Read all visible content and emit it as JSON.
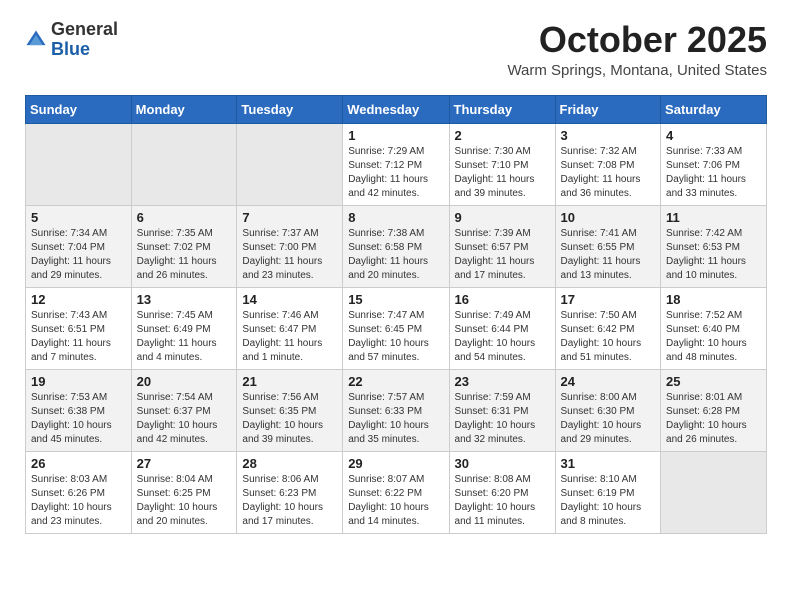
{
  "header": {
    "logo_general": "General",
    "logo_blue": "Blue",
    "month_title": "October 2025",
    "location": "Warm Springs, Montana, United States"
  },
  "weekdays": [
    "Sunday",
    "Monday",
    "Tuesday",
    "Wednesday",
    "Thursday",
    "Friday",
    "Saturday"
  ],
  "weeks": [
    [
      {
        "day": "",
        "info": ""
      },
      {
        "day": "",
        "info": ""
      },
      {
        "day": "",
        "info": ""
      },
      {
        "day": "1",
        "info": "Sunrise: 7:29 AM\nSunset: 7:12 PM\nDaylight: 11 hours\nand 42 minutes."
      },
      {
        "day": "2",
        "info": "Sunrise: 7:30 AM\nSunset: 7:10 PM\nDaylight: 11 hours\nand 39 minutes."
      },
      {
        "day": "3",
        "info": "Sunrise: 7:32 AM\nSunset: 7:08 PM\nDaylight: 11 hours\nand 36 minutes."
      },
      {
        "day": "4",
        "info": "Sunrise: 7:33 AM\nSunset: 7:06 PM\nDaylight: 11 hours\nand 33 minutes."
      }
    ],
    [
      {
        "day": "5",
        "info": "Sunrise: 7:34 AM\nSunset: 7:04 PM\nDaylight: 11 hours\nand 29 minutes."
      },
      {
        "day": "6",
        "info": "Sunrise: 7:35 AM\nSunset: 7:02 PM\nDaylight: 11 hours\nand 26 minutes."
      },
      {
        "day": "7",
        "info": "Sunrise: 7:37 AM\nSunset: 7:00 PM\nDaylight: 11 hours\nand 23 minutes."
      },
      {
        "day": "8",
        "info": "Sunrise: 7:38 AM\nSunset: 6:58 PM\nDaylight: 11 hours\nand 20 minutes."
      },
      {
        "day": "9",
        "info": "Sunrise: 7:39 AM\nSunset: 6:57 PM\nDaylight: 11 hours\nand 17 minutes."
      },
      {
        "day": "10",
        "info": "Sunrise: 7:41 AM\nSunset: 6:55 PM\nDaylight: 11 hours\nand 13 minutes."
      },
      {
        "day": "11",
        "info": "Sunrise: 7:42 AM\nSunset: 6:53 PM\nDaylight: 11 hours\nand 10 minutes."
      }
    ],
    [
      {
        "day": "12",
        "info": "Sunrise: 7:43 AM\nSunset: 6:51 PM\nDaylight: 11 hours\nand 7 minutes."
      },
      {
        "day": "13",
        "info": "Sunrise: 7:45 AM\nSunset: 6:49 PM\nDaylight: 11 hours\nand 4 minutes."
      },
      {
        "day": "14",
        "info": "Sunrise: 7:46 AM\nSunset: 6:47 PM\nDaylight: 11 hours\nand 1 minute."
      },
      {
        "day": "15",
        "info": "Sunrise: 7:47 AM\nSunset: 6:45 PM\nDaylight: 10 hours\nand 57 minutes."
      },
      {
        "day": "16",
        "info": "Sunrise: 7:49 AM\nSunset: 6:44 PM\nDaylight: 10 hours\nand 54 minutes."
      },
      {
        "day": "17",
        "info": "Sunrise: 7:50 AM\nSunset: 6:42 PM\nDaylight: 10 hours\nand 51 minutes."
      },
      {
        "day": "18",
        "info": "Sunrise: 7:52 AM\nSunset: 6:40 PM\nDaylight: 10 hours\nand 48 minutes."
      }
    ],
    [
      {
        "day": "19",
        "info": "Sunrise: 7:53 AM\nSunset: 6:38 PM\nDaylight: 10 hours\nand 45 minutes."
      },
      {
        "day": "20",
        "info": "Sunrise: 7:54 AM\nSunset: 6:37 PM\nDaylight: 10 hours\nand 42 minutes."
      },
      {
        "day": "21",
        "info": "Sunrise: 7:56 AM\nSunset: 6:35 PM\nDaylight: 10 hours\nand 39 minutes."
      },
      {
        "day": "22",
        "info": "Sunrise: 7:57 AM\nSunset: 6:33 PM\nDaylight: 10 hours\nand 35 minutes."
      },
      {
        "day": "23",
        "info": "Sunrise: 7:59 AM\nSunset: 6:31 PM\nDaylight: 10 hours\nand 32 minutes."
      },
      {
        "day": "24",
        "info": "Sunrise: 8:00 AM\nSunset: 6:30 PM\nDaylight: 10 hours\nand 29 minutes."
      },
      {
        "day": "25",
        "info": "Sunrise: 8:01 AM\nSunset: 6:28 PM\nDaylight: 10 hours\nand 26 minutes."
      }
    ],
    [
      {
        "day": "26",
        "info": "Sunrise: 8:03 AM\nSunset: 6:26 PM\nDaylight: 10 hours\nand 23 minutes."
      },
      {
        "day": "27",
        "info": "Sunrise: 8:04 AM\nSunset: 6:25 PM\nDaylight: 10 hours\nand 20 minutes."
      },
      {
        "day": "28",
        "info": "Sunrise: 8:06 AM\nSunset: 6:23 PM\nDaylight: 10 hours\nand 17 minutes."
      },
      {
        "day": "29",
        "info": "Sunrise: 8:07 AM\nSunset: 6:22 PM\nDaylight: 10 hours\nand 14 minutes."
      },
      {
        "day": "30",
        "info": "Sunrise: 8:08 AM\nSunset: 6:20 PM\nDaylight: 10 hours\nand 11 minutes."
      },
      {
        "day": "31",
        "info": "Sunrise: 8:10 AM\nSunset: 6:19 PM\nDaylight: 10 hours\nand 8 minutes."
      },
      {
        "day": "",
        "info": ""
      }
    ]
  ]
}
